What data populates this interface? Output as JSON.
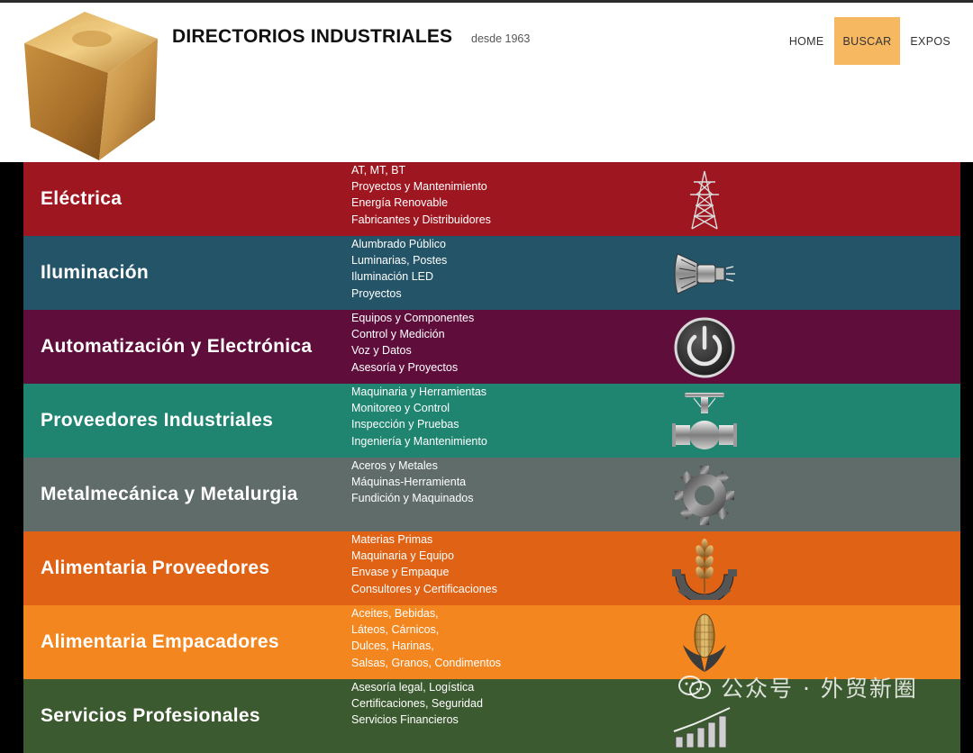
{
  "header": {
    "title": "DIRECTORIOS INDUSTRIALES",
    "tagline": "desde 1963",
    "logo_icon": "gold-cube-icon"
  },
  "nav": {
    "items": [
      {
        "label": "HOME",
        "active": false
      },
      {
        "label": "BUSCAR",
        "active": true
      },
      {
        "label": "EXPOS",
        "active": false
      }
    ]
  },
  "categories": [
    {
      "title": "Eléctrica",
      "color": "#9e1620",
      "icon": "power-tower-icon",
      "subs": [
        "AT, MT, BT",
        "Proyectos y Mantenimiento",
        "Energía Renovable",
        "Fabricantes y Distribuidores"
      ]
    },
    {
      "title": "Iluminación",
      "color": "#245468",
      "icon": "spotlight-icon",
      "subs": [
        "Alumbrado Público",
        "Luminarias, Postes",
        "Iluminación LED",
        "Proyectos"
      ]
    },
    {
      "title": "Automatización y Electrónica",
      "color": "#5f0e3c",
      "icon": "power-button-icon",
      "subs": [
        "Equipos y Componentes",
        "Control y Medición",
        "Voz y Datos",
        "Asesoría y Proyectos"
      ]
    },
    {
      "title": "Proveedores Industriales",
      "color": "#1f8470",
      "icon": "valve-icon",
      "subs": [
        "Maquinaria y Herramientas",
        "Monitoreo y Control",
        "Inspección y Pruebas",
        "Ingeniería y Mantenimiento"
      ]
    },
    {
      "title": "Metalmecánica y Metalurgia",
      "color": "#5f6c69",
      "icon": "gear-icon",
      "subs": [
        "Aceros y Metales",
        "Máquinas-Herramienta",
        "Fundición y Maquinados"
      ]
    },
    {
      "title": "Alimentaria Proveedores",
      "color": "#e06214",
      "icon": "wheat-gear-icon",
      "subs": [
        "Materias Primas",
        "Maquinaria y Equipo",
        "Envase y Empaque",
        "Consultores y Certificaciones"
      ]
    },
    {
      "title": "Alimentaria Empacadores",
      "color": "#f4861f",
      "icon": "corn-icon",
      "subs": [
        "Aceites, Bebidas,",
        "Láteos, Cárnicos,",
        "Dulces, Harinas,",
        "Salsas, Granos, Condimentos"
      ]
    },
    {
      "title": "Servicios Profesionales",
      "color": "#3c5a2f",
      "icon": "bar-growth-icon",
      "subs": [
        "Asesoría legal, Logística",
        "Certificaciones, Seguridad",
        "Servicios Financieros"
      ]
    }
  ],
  "watermark": {
    "text": "公众号 · 外贸新圈",
    "icon": "wechat-icon"
  }
}
